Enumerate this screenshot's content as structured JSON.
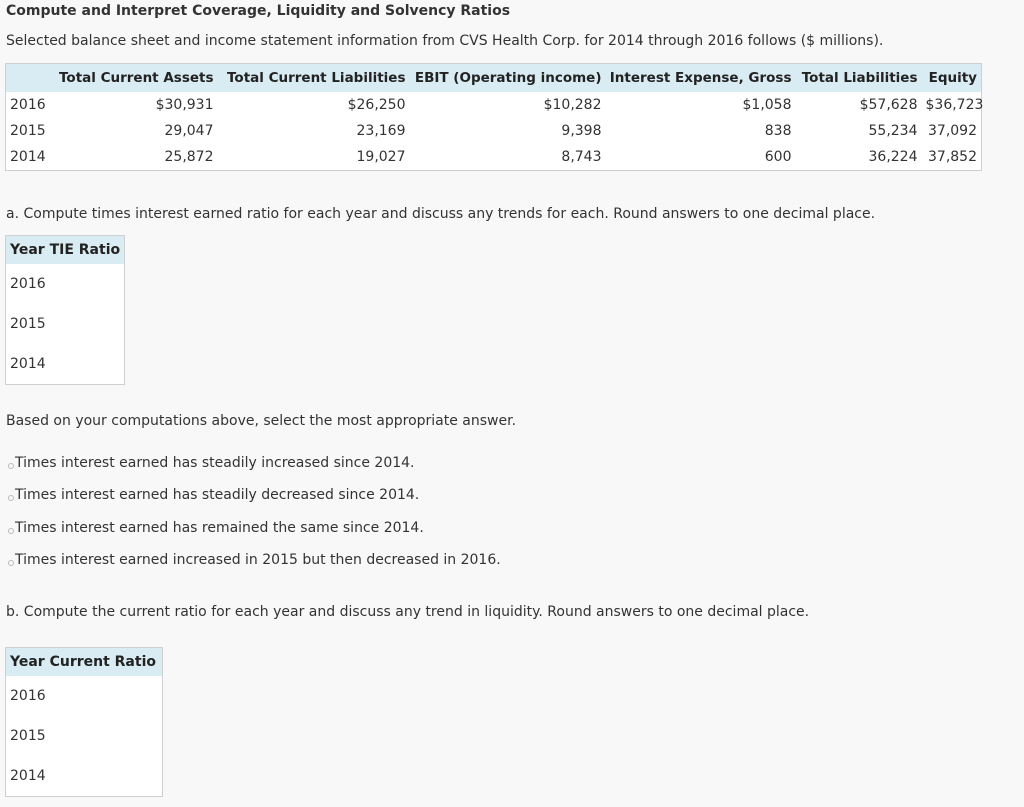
{
  "title": "Compute and Interpret Coverage, Liquidity and Solvency Ratios",
  "subtitle": "Selected balance sheet and income statement information from CVS Health Corp. for 2014 through 2016 follows ($ millions).",
  "data_table": {
    "headers": [
      "",
      "Total Current Assets",
      "Total Current Liabilities",
      "EBIT (Operating income)",
      "Interest Expense, Gross",
      "Total Liabilities",
      "Equity"
    ],
    "rows": [
      [
        "2016",
        "$30,931",
        "$26,250",
        "$10,282",
        "$1,058",
        "$57,628",
        "$36,723"
      ],
      [
        "2015",
        "29,047",
        "23,169",
        "9,398",
        "838",
        "55,234",
        "37,092"
      ],
      [
        "2014",
        "25,872",
        "19,027",
        "8,743",
        "600",
        "36,224",
        "37,852"
      ]
    ]
  },
  "part_a": {
    "question": "a. Compute times interest earned ratio for each year and discuss any trends for each. Round answers to one decimal place.",
    "headers": [
      "Year",
      "TIE Ratio"
    ],
    "years": [
      "2016",
      "2015",
      "2014"
    ],
    "prompt": "Based on your computations above, select the most appropriate answer.",
    "options": [
      "Times interest earned has steadily increased since 2014.",
      "Times interest earned has steadily decreased since 2014.",
      "Times interest earned has remained the same since 2014.",
      "Times interest earned increased in 2015 but then decreased in 2016."
    ]
  },
  "part_b": {
    "question": "b. Compute the current ratio for each year and discuss any trend in liquidity. Round answers to one decimal place.",
    "headers": [
      "Year",
      "Current Ratio"
    ],
    "years": [
      "2016",
      "2015",
      "2014"
    ]
  }
}
